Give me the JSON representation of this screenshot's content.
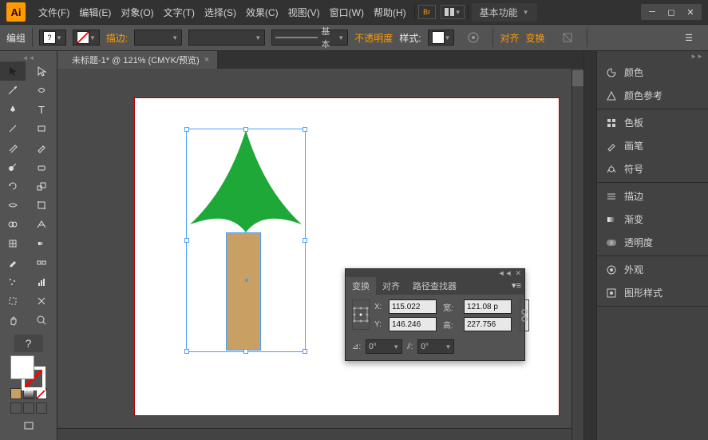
{
  "app_logo": "Ai",
  "menus": [
    "文件(F)",
    "编辑(E)",
    "对象(O)",
    "文字(T)",
    "选择(S)",
    "效果(C)",
    "视图(V)",
    "窗口(W)",
    "帮助(H)"
  ],
  "basic_fn": "基本功能",
  "options_bar": {
    "mode": "编组",
    "stroke_label": "描边:",
    "profile_label": "基本",
    "opacity_label": "不透明度",
    "style_label": "样式:",
    "align_label": "对齐",
    "transform_label": "变换"
  },
  "doc_tab": {
    "title": "未标题-1* @ 121% (CMYK/预览)",
    "close": "×"
  },
  "tool_help": "?",
  "transform_panel": {
    "tabs": [
      "变换",
      "对齐",
      "路径查找器"
    ],
    "x_label": "X:",
    "y_label": "Y:",
    "w_label": "宽:",
    "h_label": "高:",
    "x": "115.022",
    "y": "146.246",
    "w": "121.08 p",
    "h": "227.756",
    "angle_icon": "⊿:",
    "angle": "0°",
    "shear_icon": "⫽:",
    "shear": "0°"
  },
  "right_panels": [
    {
      "items": [
        {
          "icon": "palette",
          "label": "颜色"
        },
        {
          "icon": "guide",
          "label": "颜色参考"
        }
      ]
    },
    {
      "items": [
        {
          "icon": "swatches",
          "label": "色板"
        },
        {
          "icon": "brush",
          "label": "画笔"
        },
        {
          "icon": "symbol",
          "label": "符号"
        }
      ]
    },
    {
      "items": [
        {
          "icon": "stroke",
          "label": "描边"
        },
        {
          "icon": "gradient",
          "label": "渐变"
        },
        {
          "icon": "transparency",
          "label": "透明度"
        }
      ]
    },
    {
      "items": [
        {
          "icon": "appearance",
          "label": "外观"
        },
        {
          "icon": "graphic-styles",
          "label": "图形样式"
        }
      ]
    }
  ],
  "colors": {
    "tree_green": "#1ea838",
    "tree_trunk": "#c9a063",
    "selection": "#4a9eff",
    "artboard_border": "#b00020"
  }
}
